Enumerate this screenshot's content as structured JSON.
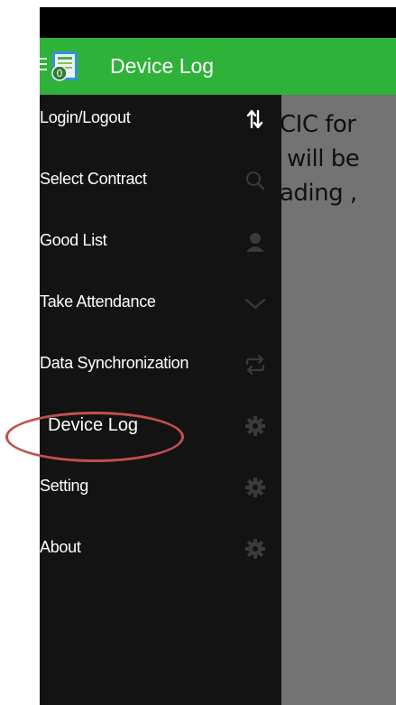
{
  "app_bar": {
    "title": "Device Log",
    "background_color": "#2fb23a",
    "menu_icon": "hamburger-icon",
    "logo_icon": "app-logo-icon"
  },
  "content": {
    "lines": [
      "CIC for",
      "will be",
      "ading ,"
    ]
  },
  "drawer": {
    "items": [
      {
        "label": "Login/Logout",
        "icon": "up-down-arrows-icon"
      },
      {
        "label": "Select Contract",
        "icon": "search-icon"
      },
      {
        "label": "Good List",
        "icon": "person-icon"
      },
      {
        "label": "Take Attendance",
        "icon": "chevron-down-icon"
      },
      {
        "label": "Data Synchronization",
        "icon": "sync-icon"
      },
      {
        "label": "Device Log",
        "icon": "gear-icon"
      },
      {
        "label": "Setting",
        "icon": "gear-icon"
      },
      {
        "label": "About",
        "icon": "gear-icon"
      }
    ]
  },
  "annotation": {
    "ring_color": "#c0504d"
  }
}
